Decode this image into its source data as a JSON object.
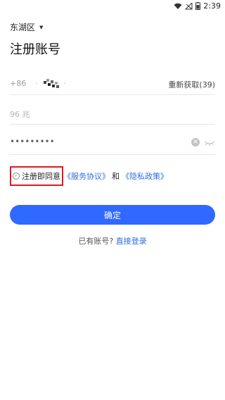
{
  "status": {
    "time": "2:39"
  },
  "region": {
    "label": "东湖区"
  },
  "page": {
    "title": "注册账号"
  },
  "phone": {
    "country_code": "+86",
    "value": "· · ···· ·",
    "resend_label": "重新获取(39)"
  },
  "code": {
    "value": "96 兆"
  },
  "password": {
    "value": "•••••••••"
  },
  "agreement": {
    "prefix": "注册即同意",
    "service_link": "《服务协议》",
    "and": "和",
    "privacy_link": "《隐私政策》"
  },
  "actions": {
    "confirm_label": "确定"
  },
  "login": {
    "prompt": "已有账号?",
    "link": "直接登录"
  },
  "colors": {
    "primary": "#2f69ff",
    "link": "#2e6be6",
    "highlight_border": "#e0181f"
  }
}
